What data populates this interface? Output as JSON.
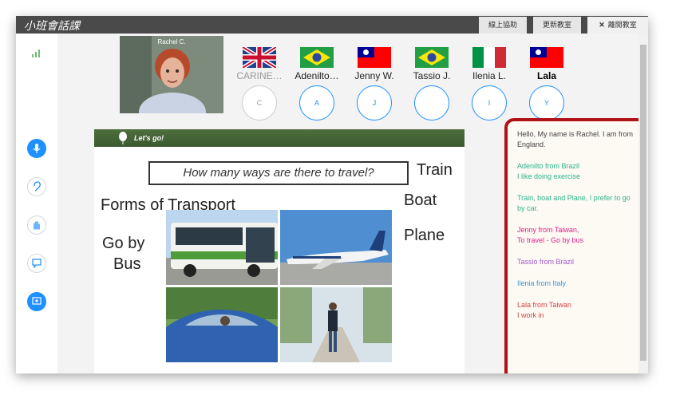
{
  "app": {
    "title": "小班會話課"
  },
  "toolbar": {
    "help": "線上協助",
    "refresh": "更新教室",
    "leave": "離開教室",
    "leave_icon": "✕"
  },
  "sidebar": {
    "info_label": "i"
  },
  "teacher": {
    "name": "Rachel C."
  },
  "participants": [
    {
      "name": "CARINE…",
      "initial": "C",
      "flag": "uk"
    },
    {
      "name": "Adenilto…",
      "initial": "A",
      "flag": "brazil"
    },
    {
      "name": "Jenny W.",
      "initial": "J",
      "flag": "taiwan"
    },
    {
      "name": "Tassio J.",
      "initial": "",
      "flag": "brazil"
    },
    {
      "name": "Ilenia L.",
      "initial": "I",
      "flag": "italy"
    },
    {
      "name": "Lala",
      "initial": "Y",
      "flag": "taiwan"
    }
  ],
  "slide": {
    "header": "Let's go!",
    "question": "How many ways are there to travel?",
    "forms_label": "Forms of Transport",
    "go_by": "Go by",
    "bus": "Bus",
    "train": "Train",
    "boat": "Boat",
    "plane": "Plane"
  },
  "chat": [
    {
      "lines": [
        "Hello, My name is Rachel. I am from",
        "England."
      ],
      "color": "#444444"
    },
    {
      "lines": [
        "Adenilto from Brazil",
        "I like doing exercise"
      ],
      "color": "#2bb58e"
    },
    {
      "lines": [
        "Train, boat and Plane, I prefer to go",
        "by car."
      ],
      "color": "#2bb58e"
    },
    {
      "lines": [
        "Jenny from Taiwan,",
        "To travel - Go by bus"
      ],
      "color": "#e0238a"
    },
    {
      "lines": [
        "Tassio from Brazil"
      ],
      "color": "#a05cd6"
    },
    {
      "lines": [
        "Ilenia from Italy"
      ],
      "color": "#3a9ad9"
    },
    {
      "lines": [
        "Lala from Taiwan",
        "I work in"
      ],
      "color": "#d64545"
    }
  ],
  "colors": {
    "accent": "#1e90ff",
    "highlight": "#b01217"
  }
}
